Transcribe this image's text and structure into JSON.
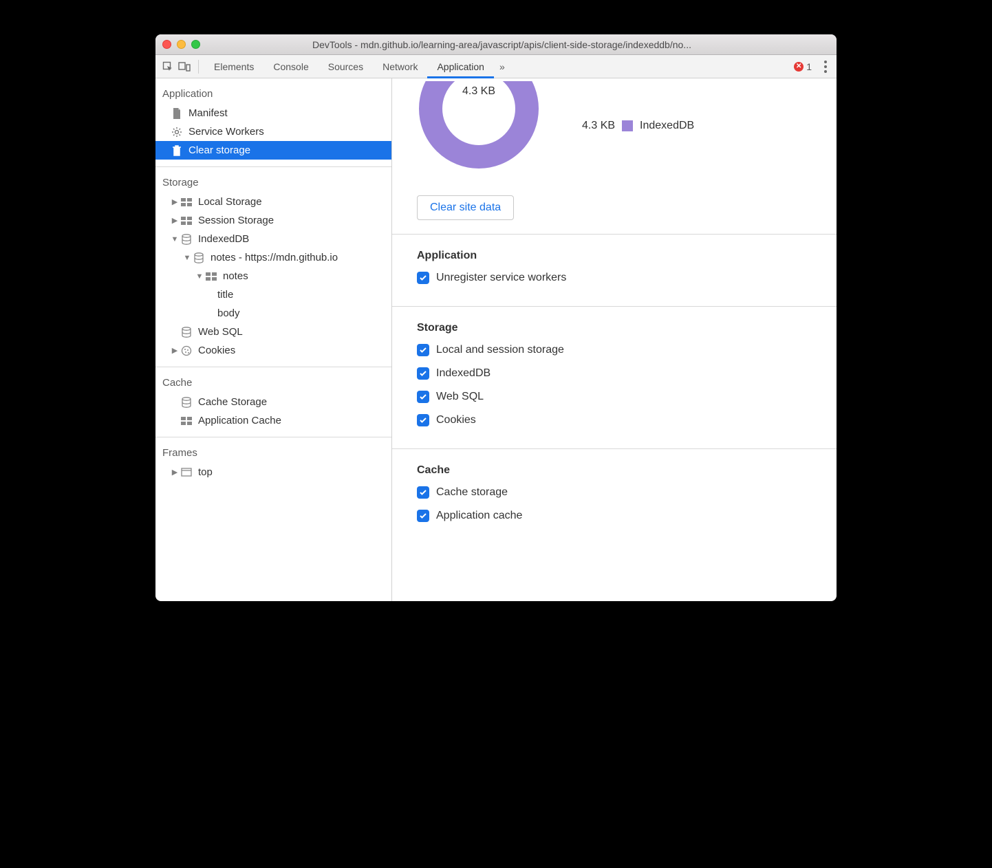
{
  "window": {
    "title": "DevTools - mdn.github.io/learning-area/javascript/apis/client-side-storage/indexeddb/no..."
  },
  "tabs": {
    "elements": "Elements",
    "console": "Console",
    "sources": "Sources",
    "network": "Network",
    "application": "Application",
    "overflow_glyph": "»"
  },
  "errors": {
    "count": "1"
  },
  "sidebar": {
    "application": {
      "title": "Application",
      "manifest": "Manifest",
      "service_workers": "Service Workers",
      "clear_storage": "Clear storage"
    },
    "storage": {
      "title": "Storage",
      "local_storage": "Local Storage",
      "session_storage": "Session Storage",
      "indexeddb": "IndexedDB",
      "idb_database": "notes - https://mdn.github.io",
      "idb_store": "notes",
      "idb_field_title": "title",
      "idb_field_body": "body",
      "web_sql": "Web SQL",
      "cookies": "Cookies"
    },
    "cache": {
      "title": "Cache",
      "cache_storage": "Cache Storage",
      "application_cache": "Application Cache"
    },
    "frames": {
      "title": "Frames",
      "top": "top"
    }
  },
  "main": {
    "usage": {
      "total": "4.3 KB",
      "legend_size": "4.3 KB",
      "legend_label": "IndexedDB",
      "legend_color": "#9b84d8"
    },
    "clear_button": "Clear site data",
    "application_section": {
      "title": "Application",
      "unregister_sw": "Unregister service workers"
    },
    "storage_section": {
      "title": "Storage",
      "local_session": "Local and session storage",
      "indexeddb": "IndexedDB",
      "web_sql": "Web SQL",
      "cookies": "Cookies"
    },
    "cache_section": {
      "title": "Cache",
      "cache_storage": "Cache storage",
      "application_cache": "Application cache"
    }
  }
}
